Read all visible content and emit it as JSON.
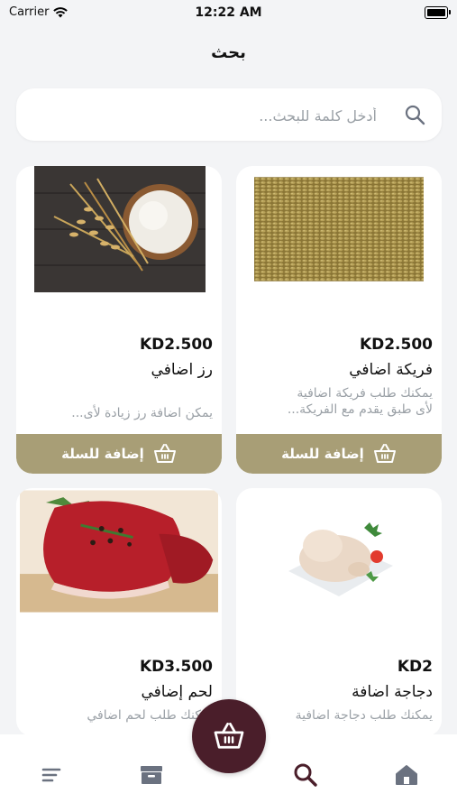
{
  "status": {
    "carrier": "Carrier",
    "time": "12:22 AM"
  },
  "header": {
    "title": "بحث"
  },
  "search": {
    "placeholder": "أدخل كلمة للبحث..."
  },
  "products": [
    {
      "price": "KD2.500",
      "name": "فريكة اضافي",
      "desc_line1": "يمكنك طلب فريكة اضافية",
      "desc_line2": "لأى طبق يقدم مع الفريكة...",
      "add_label": "إضافة للسلة"
    },
    {
      "price": "KD2.500",
      "name": "رز اضافي",
      "desc_line1": "يمكن اضافة رز زيادة لأى...",
      "desc_line2": "",
      "add_label": "إضافة للسلة"
    },
    {
      "price": "KD2",
      "name": "دجاجة اضافة",
      "desc_line1": "يمكنك طلب دجاجة اضافية",
      "desc_line2": ""
    },
    {
      "price": "KD3.500",
      "name": "لحم إضافي",
      "desc_line1": "يمكنك طلب لحم اضافي",
      "desc_line2": ""
    }
  ],
  "colors": {
    "accent": "#a89e76",
    "fab": "#4a1e2a",
    "active_nav": "#4a1e2a",
    "inactive_nav": "#6b7280"
  },
  "nav": {
    "icons": [
      "menu-icon",
      "archive-icon",
      "search-icon",
      "home-icon"
    ],
    "active": "search-icon"
  }
}
